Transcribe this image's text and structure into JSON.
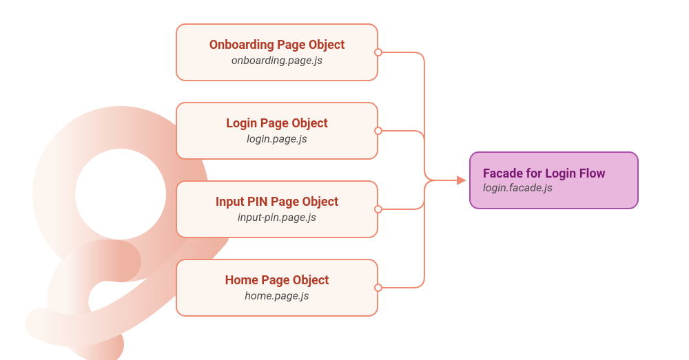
{
  "page_objects": [
    {
      "title": "Onboarding Page Object",
      "file": "onboarding.page.js"
    },
    {
      "title": "Login Page Object",
      "file": "login.page.js"
    },
    {
      "title": "Input PIN Page Object",
      "file": "input-pin.page.js"
    },
    {
      "title": "Home Page Object",
      "file": "home.page.js"
    }
  ],
  "facade": {
    "title": "Facade for Login Flow",
    "file": "login.facade.js"
  },
  "colors": {
    "page_border": "#ee8b73",
    "page_bg": "#fdf5f0",
    "page_title": "#b13b27",
    "facade_border": "#a84ea8",
    "facade_bg": "#e9b7de",
    "facade_title": "#7b1a73",
    "swirl": "#f5cfc4"
  }
}
